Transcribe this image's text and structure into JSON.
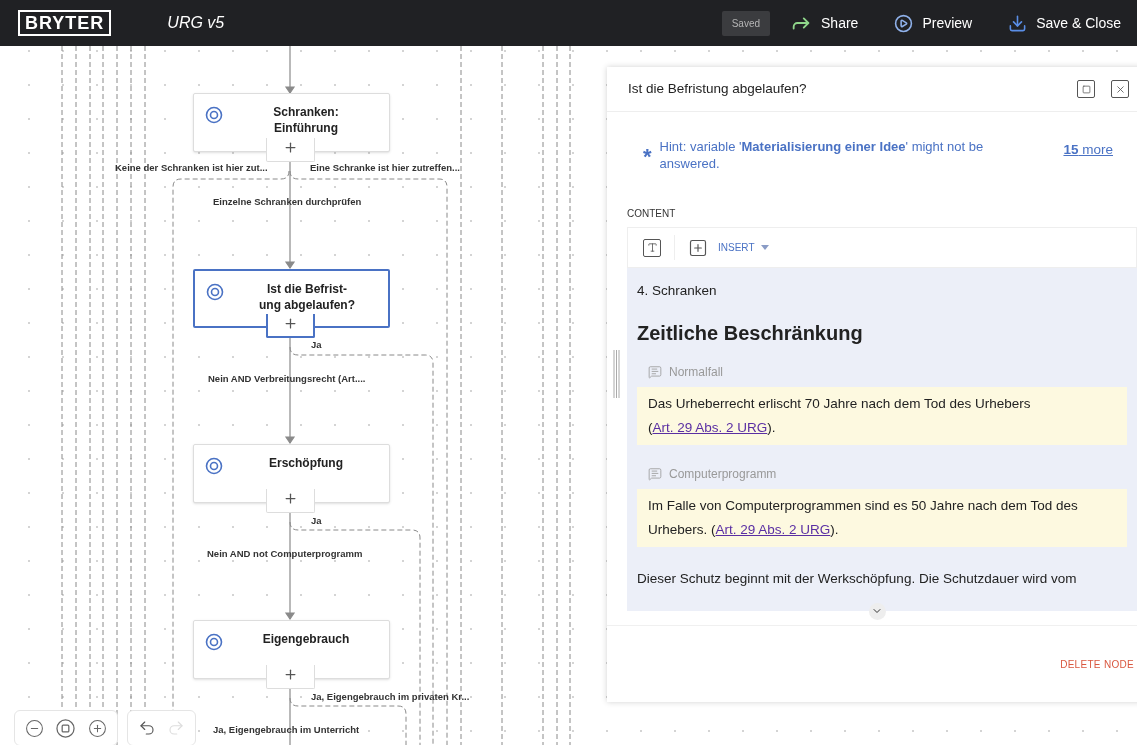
{
  "top_bar": {
    "logo": "BRYTER",
    "title": "URG v5",
    "status": "Saved",
    "actions": [
      {
        "kind": "share",
        "label": "Share"
      },
      {
        "kind": "preview",
        "label": "Preview"
      },
      {
        "kind": "save",
        "label": "Save & Close"
      }
    ]
  },
  "canvas": {
    "nodes": [
      {
        "title": "Schranken: Einführung",
        "selected": false
      },
      {
        "title": "Ist die Befrist-\nung abgelaufen?",
        "selected": true
      },
      {
        "title": "Erschöpfung",
        "selected": false
      },
      {
        "title": "Eigengebrauch",
        "selected": false
      }
    ],
    "edge_labels": [
      {
        "text": "Keine der Schranken ist hier zut..."
      },
      {
        "text": "Eine Schranke ist hier zutreffen..."
      },
      {
        "text": "Einzelne Schranken durchprüfen"
      },
      {
        "text": "Ja"
      },
      {
        "text": "Nein AND Verbreitungsrecht (Art...."
      },
      {
        "text": "Ja"
      },
      {
        "text": "Nein AND not Computerprogramm"
      },
      {
        "text": "Ja, Eigengebrauch im privaten Kr..."
      },
      {
        "text": "Ja, Eigengebrauch im Unterricht"
      }
    ],
    "history": {
      "can_undo": true,
      "can_redo": false
    }
  },
  "panel": {
    "title": "Ist die Befristung abgelaufen?",
    "hint": {
      "mark": "*",
      "text": "Hint: variable '**Materialisierung einer Idee**' might not be answered.",
      "more": "**15** more"
    },
    "content_label": "CONTENT",
    "toolbar": {
      "insert_label": "INSERT"
    },
    "content": {
      "section": "4. Schranken",
      "heading": "Zeitliche Beschränkung",
      "blocks": [
        {
          "kind": "condition",
          "label": "Normalfall",
          "text": "Das Urheberrecht erlischt 70 Jahre nach dem Tod des Urhebers (",
          "link": "Art. 29 Abs. 2 URG",
          "after": ")."
        },
        {
          "kind": "condition",
          "label": "Computerprogramm",
          "text": "Im Falle von Computerprogrammen sind es 50 Jahre nach dem Tod des Urhebers. (",
          "link": "Art. 29 Abs. 2 URG",
          "after": ")."
        },
        {
          "kind": "paragraph",
          "text": "Dieser Schutz beginnt mit der Werkschöpfung. Die Schutzdauer wird vom"
        }
      ]
    },
    "delete_label": "DELETE NODE"
  }
}
